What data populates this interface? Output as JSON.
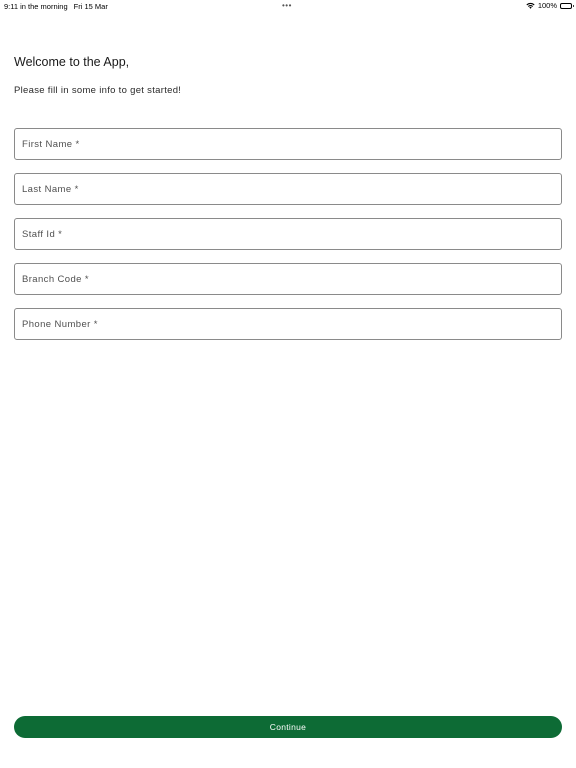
{
  "status_bar": {
    "time": "9:11 in the morning",
    "date": "Fri 15 Mar",
    "dots": "•••",
    "battery_percent": "100%",
    "battery_level": 1.0,
    "icons": [
      "wifi-icon",
      "battery-icon"
    ]
  },
  "welcome": {
    "title": "Welcome to the App,",
    "subtitle": "Please fill in some info to get started!"
  },
  "form": {
    "fields": [
      {
        "placeholder": "First Name *",
        "value": ""
      },
      {
        "placeholder": "Last Name *",
        "value": ""
      },
      {
        "placeholder": "Staff Id *",
        "value": ""
      },
      {
        "placeholder": "Branch Code *",
        "value": ""
      },
      {
        "placeholder": "Phone Number *",
        "value": ""
      }
    ]
  },
  "actions": {
    "continue_label": "Continue"
  },
  "colors": {
    "primary_button": "#0d6b35",
    "field_border": "#8a8a8a",
    "background": "#ffffff"
  }
}
